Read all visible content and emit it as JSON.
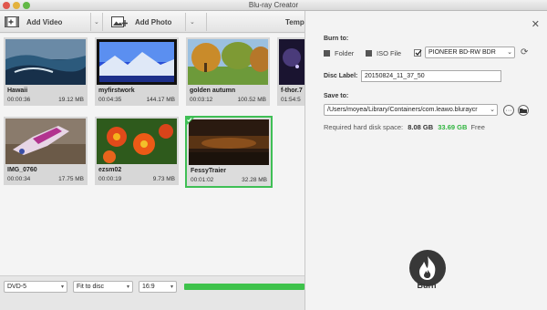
{
  "window": {
    "title": "Blu-ray Creator"
  },
  "toolbar": {
    "add_video": "Add Video",
    "add_photo": "Add Photo",
    "template": "Temp"
  },
  "media": [
    {
      "name": "Hawaii",
      "duration": "00:00:36",
      "size": "19.12 MB"
    },
    {
      "name": "myfirstwork",
      "duration": "00:04:35",
      "size": "144.17 MB"
    },
    {
      "name": "golden autumn",
      "duration": "00:03:12",
      "size": "100.52 MB"
    },
    {
      "name": "f-thor.7",
      "duration": "01:54:5",
      "size": ""
    },
    {
      "name": "IMG_0760",
      "duration": "00:00:34",
      "size": "17.75 MB"
    },
    {
      "name": "ezsm02",
      "duration": "00:00:19",
      "size": "9.73 MB"
    },
    {
      "name": "FessyTraier",
      "duration": "00:01:02",
      "size": "32.28 MB",
      "selected": true
    }
  ],
  "bottom": {
    "disc_type": "DVD-5",
    "fit": "Fit to disc",
    "aspect": "16:9",
    "progress": 1.0
  },
  "panel": {
    "burn_to": "Burn to:",
    "folder": "Folder",
    "iso": "ISO File",
    "drive": "PIONEER BD-RW   BDR",
    "disc_label_lbl": "Disc Label:",
    "disc_label": "20150824_11_37_50",
    "save_to": "Save to:",
    "save_path": "/Users/moyea/Library/Containers/com.leawo.bluraycr",
    "space_lbl": "Required hard disk space:",
    "space_required": "8.08 GB",
    "space_free": "33.69 GB",
    "free_lbl": "Free",
    "burn": "Burn"
  },
  "colors": {
    "green": "#3ec24b",
    "free_green": "#2fb43e"
  }
}
